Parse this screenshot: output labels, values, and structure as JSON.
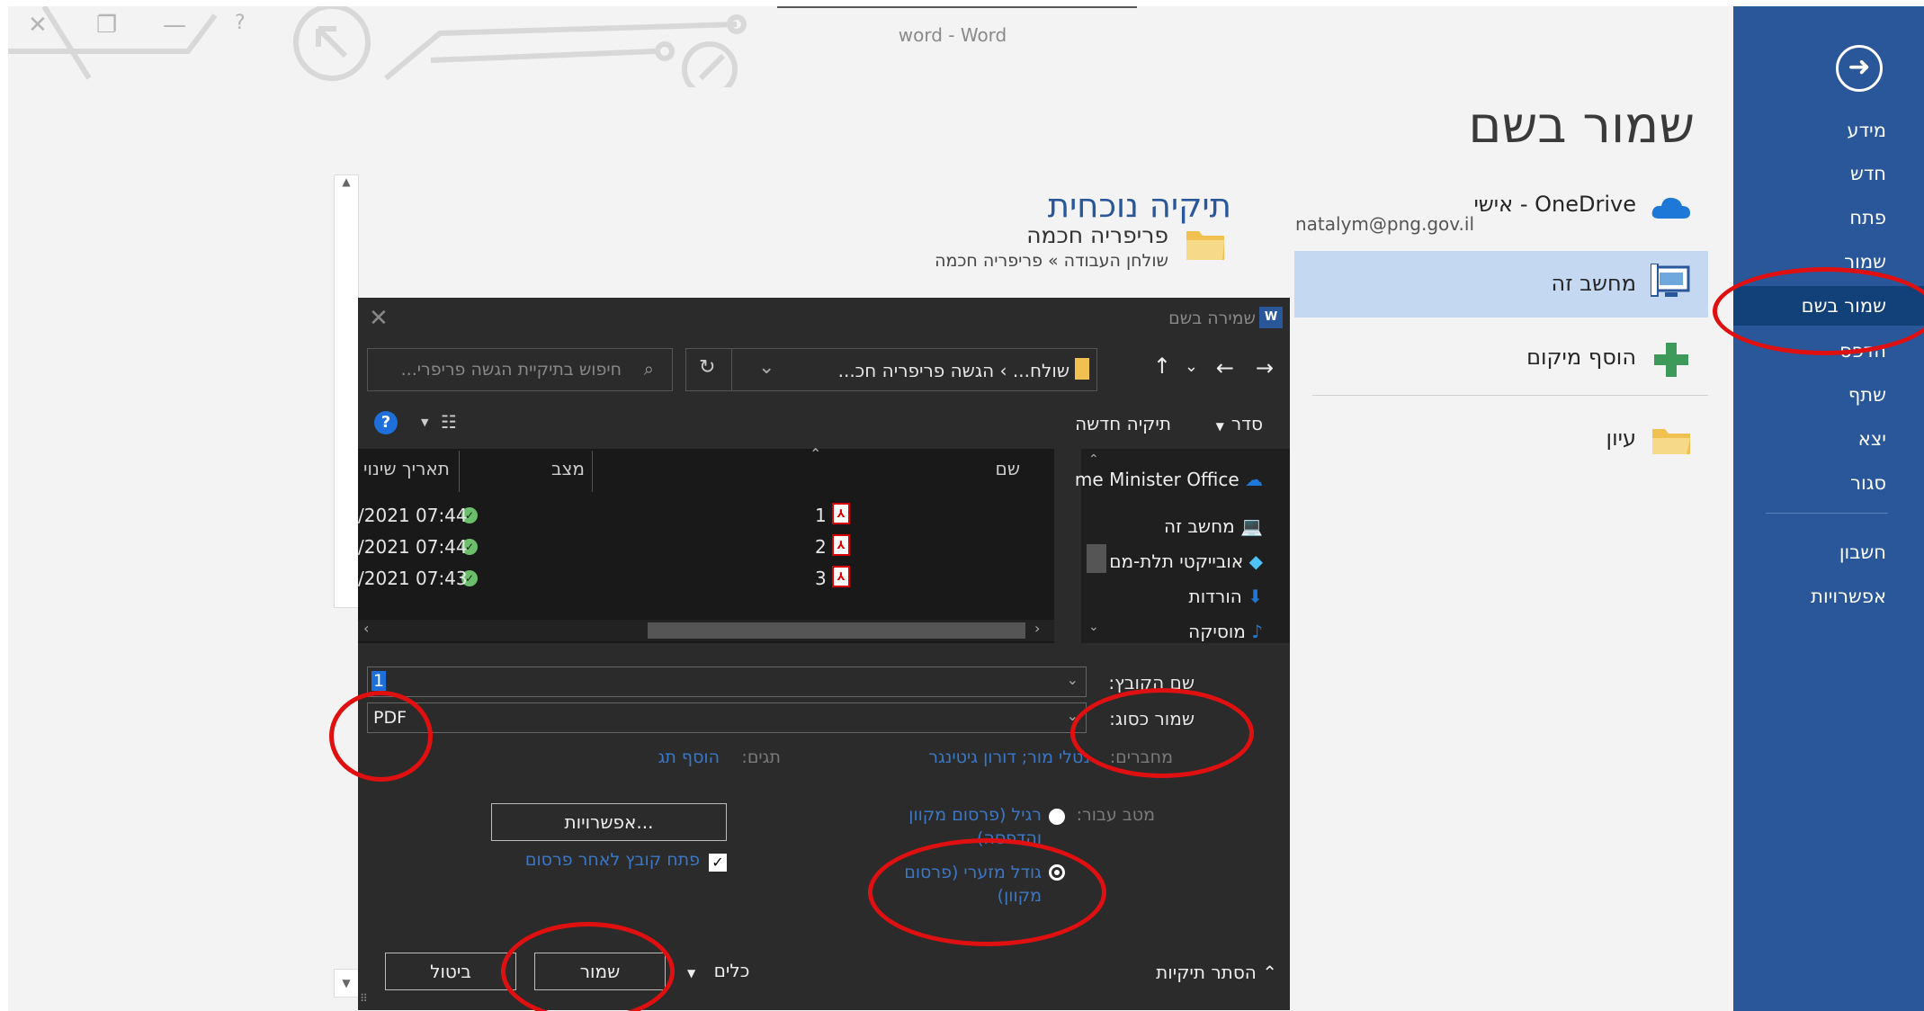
{
  "window": {
    "title": "word - Word"
  },
  "sidebar": {
    "items": [
      {
        "label": "מידע"
      },
      {
        "label": "חדש"
      },
      {
        "label": "פתח"
      },
      {
        "label": "שמור"
      },
      {
        "label": "שמור בשם"
      },
      {
        "label": "הדפס"
      },
      {
        "label": "שתף"
      },
      {
        "label": "יצא"
      },
      {
        "label": "סגור"
      },
      {
        "label": "חשבון"
      },
      {
        "label": "אפשרויות"
      }
    ],
    "selected": "שמור בשם"
  },
  "page": {
    "title": "שמור בשם",
    "locations": [
      {
        "label": "OneDrive - אישי",
        "sub": "natalym@png.gov.il",
        "icon": "onedrive-cloud-icon"
      },
      {
        "label": "מחשב זה",
        "icon": "computer-icon"
      },
      {
        "label": "הוסף מיקום",
        "icon": "plus-icon"
      },
      {
        "label": "עיון",
        "icon": "folder-icon"
      }
    ],
    "current_folder": {
      "title": "תיקיה נוכחית",
      "name": "פריפריה חכמה",
      "path": "שולחן העבודה » פריפריה חכמה"
    }
  },
  "dialog": {
    "title": "שמירה בשם",
    "address_path": "שולח... › הגשה פריפריה חכ...",
    "search_placeholder": "חיפוש בתיקיית הגשה פריפרי...",
    "toolbar": {
      "organize": "סדר",
      "new_folder": "תיקיה חדשה"
    },
    "nav": [
      {
        "label": "me Minister Office",
        "icon": "onedrive-cloud-icon"
      },
      {
        "label": "מחשב זה",
        "icon": "computer-icon"
      },
      {
        "label": "אובייקטי תלת-מם",
        "icon": "3d-objects-icon"
      },
      {
        "label": "הורדות",
        "icon": "download-icon"
      },
      {
        "label": "מוסיקה",
        "icon": "music-icon"
      }
    ],
    "columns": {
      "name": "שם",
      "status": "מצב",
      "modified": "תאריך שינוי"
    },
    "files": [
      {
        "name": "1",
        "modified": "/2021 07:44"
      },
      {
        "name": "2",
        "modified": "/2021 07:44"
      },
      {
        "name": "3",
        "modified": "/2021 07:43"
      }
    ],
    "filename_label": "שם הקובץ:",
    "filename_value": "1",
    "savetype_label": "שמור כסוג:",
    "savetype_value": "PDF",
    "authors_label": "מחברים:",
    "authors_value": "נטלי מור; דורון גיטינגר",
    "tags_label": "תגים:",
    "tags_value": "הוסף תג",
    "optimize_label": "מטב עבור:",
    "radio_standard": "רגיל (פרסום מקוון והדפסה)",
    "radio_minimum": "גודל מזערי (פרסום מקוון)",
    "options_button": "אפשרויות...",
    "open_after": "פתח קובץ לאחר פרסום",
    "hide_folders": "הסתר תיקיות",
    "tools": "כלים",
    "save_button": "שמור",
    "cancel_button": "ביטול"
  },
  "colors": {
    "sidebar": "#2a579a",
    "sidebar_selected": "#124078",
    "annotation": "#e01010",
    "dialog_bg": "#2b2b2b",
    "link": "#3a78c7"
  }
}
